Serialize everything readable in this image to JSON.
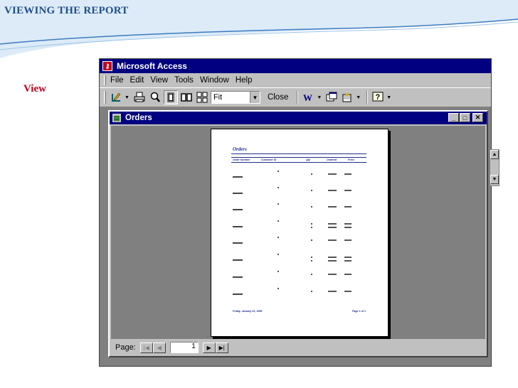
{
  "slide": {
    "title": "VIEWING THE REPORT",
    "side_label": "View"
  },
  "app": {
    "title": "Microsoft Access",
    "menu": [
      "File",
      "Edit",
      "View",
      "Tools",
      "Window",
      "Help"
    ],
    "toolbar": {
      "zoom_value": "Fit",
      "close_label": "Close",
      "buttons": [
        "design-view-icon",
        "print-icon",
        "zoom-icon",
        "one-page-icon",
        "two-pages-icon",
        "multiple-pages-icon",
        "office-links-icon",
        "database-window-icon",
        "new-object-icon",
        "help-icon"
      ]
    }
  },
  "document": {
    "title": "Orders",
    "report": {
      "title": "Orders",
      "columns": [
        "Order Number",
        "Customer ID",
        "Qty",
        "Ordered",
        "Price"
      ],
      "footer_left": "Friday, January 01, 1999",
      "footer_right": "Page 1 of 1"
    },
    "navigation": {
      "label": "Page:",
      "page_number": "1"
    }
  },
  "colors": {
    "title_blue": "#1f4e8c",
    "label_red": "#c0001a",
    "titlebar": "#000080"
  }
}
